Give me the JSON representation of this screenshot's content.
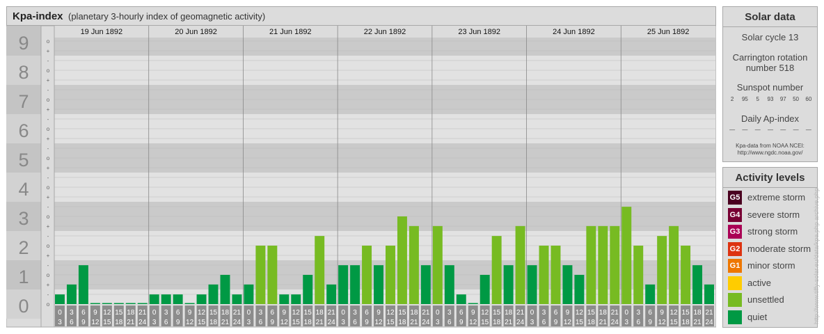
{
  "header": {
    "title": "Kpa-index",
    "subtitle": "(planetary 3-hourly index of geomagnetic activity)"
  },
  "chart_data": {
    "type": "bar",
    "title": "Kpa-index",
    "subtitle": "(planetary 3-hourly index of geomagnetic activity)",
    "ylim": [
      0,
      9.33
    ],
    "y_major_ticks": [
      "0",
      "1",
      "2",
      "3",
      "4",
      "5",
      "6",
      "7",
      "8",
      "9"
    ],
    "y_minor_marks": [
      "+",
      "o",
      "-"
    ],
    "days": [
      "19 Jun 1892",
      "20 Jun 1892",
      "21 Jun 1892",
      "22 Jun 1892",
      "23 Jun 1892",
      "24 Jun 1892",
      "25 Jun 1892"
    ],
    "hour_starts": [
      "0",
      "3",
      "6",
      "9",
      "12",
      "15",
      "18",
      "21"
    ],
    "hour_ends": [
      "3",
      "6",
      "9",
      "12",
      "15",
      "18",
      "21",
      "24"
    ],
    "values": [
      [
        0.33,
        0.67,
        1.33,
        0,
        0,
        0,
        0,
        0
      ],
      [
        0.33,
        0.33,
        0.33,
        0,
        0.33,
        0.67,
        1,
        0.33
      ],
      [
        0.67,
        2,
        2,
        0.33,
        0.33,
        1,
        2.33,
        0.67
      ],
      [
        1.33,
        1.33,
        2,
        1.33,
        2,
        3,
        2.67,
        1.33
      ],
      [
        2.67,
        1.33,
        0.33,
        0,
        1,
        2.33,
        1.33,
        2.67
      ],
      [
        1.33,
        2,
        2,
        1.33,
        1,
        2.67,
        2.67,
        2.67
      ],
      [
        3.33,
        2,
        0.67,
        2.33,
        2.67,
        2,
        1.33,
        0.67
      ]
    ],
    "colors": {
      "quiet": "#009944",
      "unsettled": "#77bb22"
    }
  },
  "solar": {
    "title": "Solar data",
    "cycle": "Solar cycle 13",
    "rotation_line1": "Carrington rotation",
    "rotation_line2": "number 518",
    "sunspot_title": "Sunspot number",
    "sunspots": [
      "2",
      "95",
      "5",
      "93",
      "97",
      "50",
      "60"
    ],
    "ap_title": "Daily Ap-index",
    "ap_values": [
      "—",
      "—",
      "—",
      "—",
      "—",
      "—",
      "—"
    ],
    "source_line1": "Kpa-data from NOAA NCEI:",
    "source_line2": "http://www.ngdc.noaa.gov/"
  },
  "activity": {
    "title": "Activity levels",
    "levels": [
      {
        "badge": "G5",
        "label": "extreme storm",
        "color": "#4a0020"
      },
      {
        "badge": "G4",
        "label": "severe storm",
        "color": "#770033"
      },
      {
        "badge": "G3",
        "label": "strong storm",
        "color": "#aa0055"
      },
      {
        "badge": "G2",
        "label": "moderate storm",
        "color": "#dd3311"
      },
      {
        "badge": "G1",
        "label": "minor storm",
        "color": "#ee7700"
      },
      {
        "badge": "",
        "label": "active",
        "color": "#ffcc00"
      },
      {
        "badge": "",
        "label": "unsettled",
        "color": "#77bb22"
      },
      {
        "badge": "",
        "label": "quiet",
        "color": "#009944"
      }
    ]
  },
  "watermark": "http://www.tiffy-solar.eu/data/kpa.php archive.php"
}
